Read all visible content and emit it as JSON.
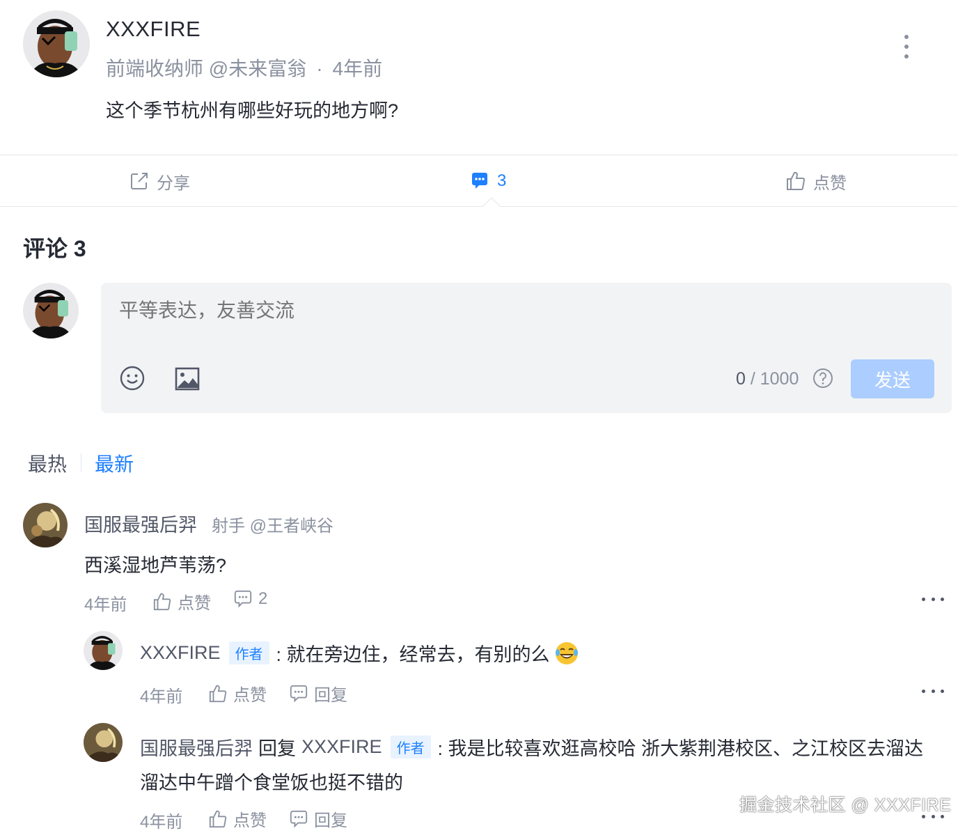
{
  "post": {
    "author": "XXXFIRE",
    "job": "前端收纳师 @未来富翁",
    "dot": "·",
    "time": "4年前",
    "content": "这个季节杭州有哪些好玩的地方啊?",
    "more_icon": "more-vertical-icon"
  },
  "actions": {
    "share_label": "分享",
    "comment_count": "3",
    "like_label": "点赞"
  },
  "comments_section": {
    "title": "评论 3",
    "input_placeholder": "平等表达，友善交流",
    "counter_current": "0",
    "counter_sep": " / ",
    "counter_max": "1000",
    "send_label": "发送",
    "accent_color": "#1e80ff",
    "send_disabled_color": "#abcdff"
  },
  "sort": {
    "hot": "最热",
    "new": "最新",
    "active": "最新"
  },
  "comments": [
    {
      "name": "国服最强后羿",
      "job": "射手 @王者峡谷",
      "text": "西溪湿地芦苇荡?",
      "time": "4年前",
      "like": "点赞",
      "reply_count": "2",
      "replies": [
        {
          "name": "XXXFIRE",
          "badge": "作者",
          "text": ": 就在旁边住，经常去，有别的么",
          "time": "4年前",
          "like": "点赞",
          "reply": "回复"
        },
        {
          "name": "国服最强后羿",
          "reply_word": "回复",
          "target": "XXXFIRE",
          "badge": "作者",
          "text_line1": ": 我是比较喜欢逛高校哈 浙大紫荆港校区、之江校区去溜达",
          "text_line2": "溜达中午蹭个食堂饭也挺不错的",
          "time": "4年前",
          "like": "点赞",
          "reply": "回复"
        }
      ]
    }
  ],
  "watermark": "掘金技术社区 @ XXXFIRE"
}
